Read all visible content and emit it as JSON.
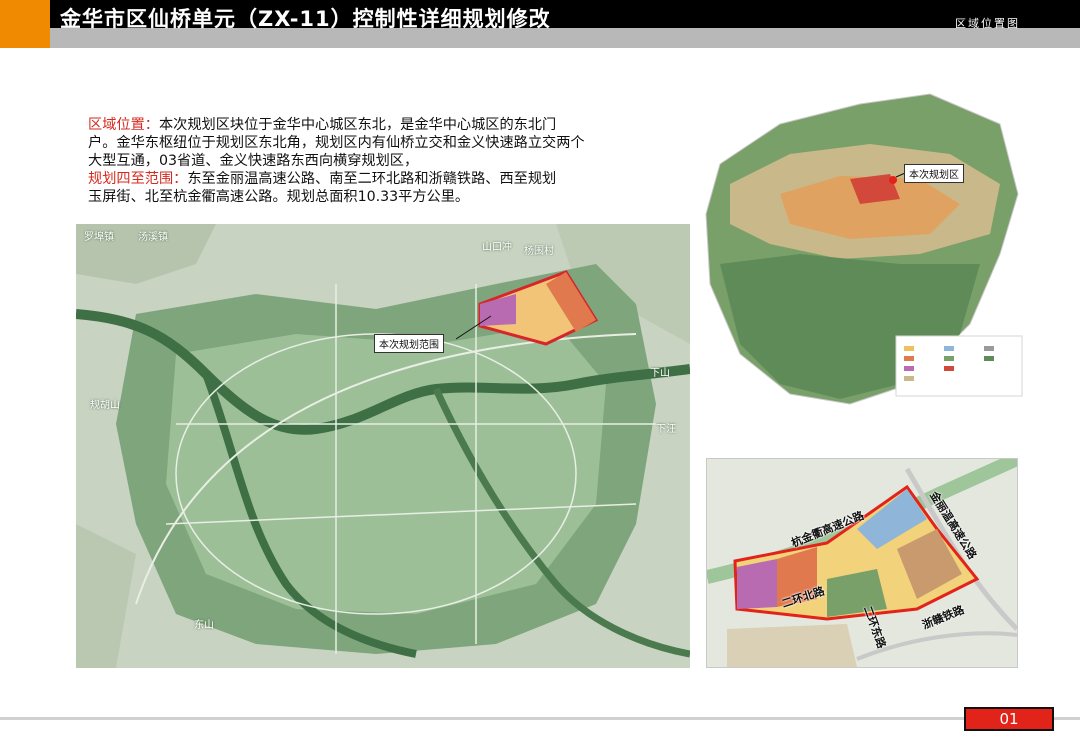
{
  "header": {
    "title": "金华市区仙桥单元（ZX-11）控制性详细规划修改",
    "subtitle": "区域位置图"
  },
  "description": {
    "location_key": "区域位置：",
    "location_line1": "本次规划区块位于金华中心城区东北，是金华中心城区的东北门",
    "location_line2": "户。金华东枢纽位于规划区东北角，规划区内有仙桥立交和金义快速路立交两个",
    "location_line3": "大型互通，03省道、金义快速路东西向横穿规划区，",
    "boundary_key": "规划四至范围：",
    "boundary_line1": "东至金丽温高速公路、南至二环北路和浙赣铁路、西至规划",
    "boundary_line2": "玉屏街、北至杭金衢高速公路。规划总面积10.33平方公里。"
  },
  "main_map": {
    "label": "本次规划范围",
    "places": [
      "罗埠镇",
      "汤溪镇",
      "山口冲",
      "杨围村",
      "下山",
      "下汪",
      "东山",
      "规胡山"
    ]
  },
  "region_map": {
    "label": "本次规划区"
  },
  "detail_map": {
    "roads": [
      "杭金衢高速公路",
      "金丽温高速公路",
      "二环北路",
      "二环东路",
      "浙赣铁路"
    ]
  },
  "footer": {
    "page_number": "01"
  },
  "colors": {
    "header_black": "#000000",
    "header_orange": "#f08a00",
    "accent_red": "#e2231a",
    "key_text_red": "#d62a1f",
    "map_green": "#4f7f4d"
  }
}
